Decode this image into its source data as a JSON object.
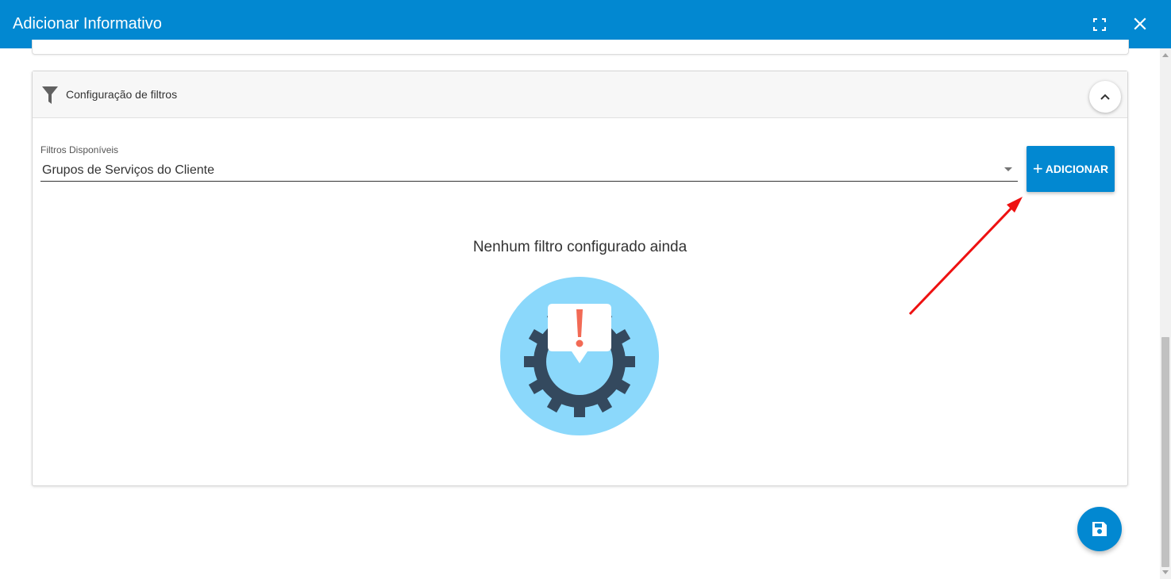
{
  "dialog": {
    "title": "Adicionar Informativo",
    "fullscreen_icon": "fullscreen-icon",
    "close_icon": "close-icon"
  },
  "filter_section": {
    "header_icon": "filter-funnel-icon",
    "title": "Configuração de filtros",
    "collapse_icon": "chevron-up-icon",
    "select_label": "Filtros Disponíveis",
    "select_value": "Grupos de Serviços do Cliente",
    "add_button_label": "ADICIONAR",
    "add_button_icon": "plus-icon",
    "empty_message": "Nenhum filtro configurado ainda",
    "empty_illustration": "gear-alert-illustration"
  },
  "actions": {
    "save_icon": "floppy-disk-icon"
  },
  "colors": {
    "primary": "#0288d1",
    "illustration_bg": "#8bd8fb",
    "gear": "#34495e",
    "alert": "#f26a55",
    "annotation_arrow": "#ee1111"
  }
}
